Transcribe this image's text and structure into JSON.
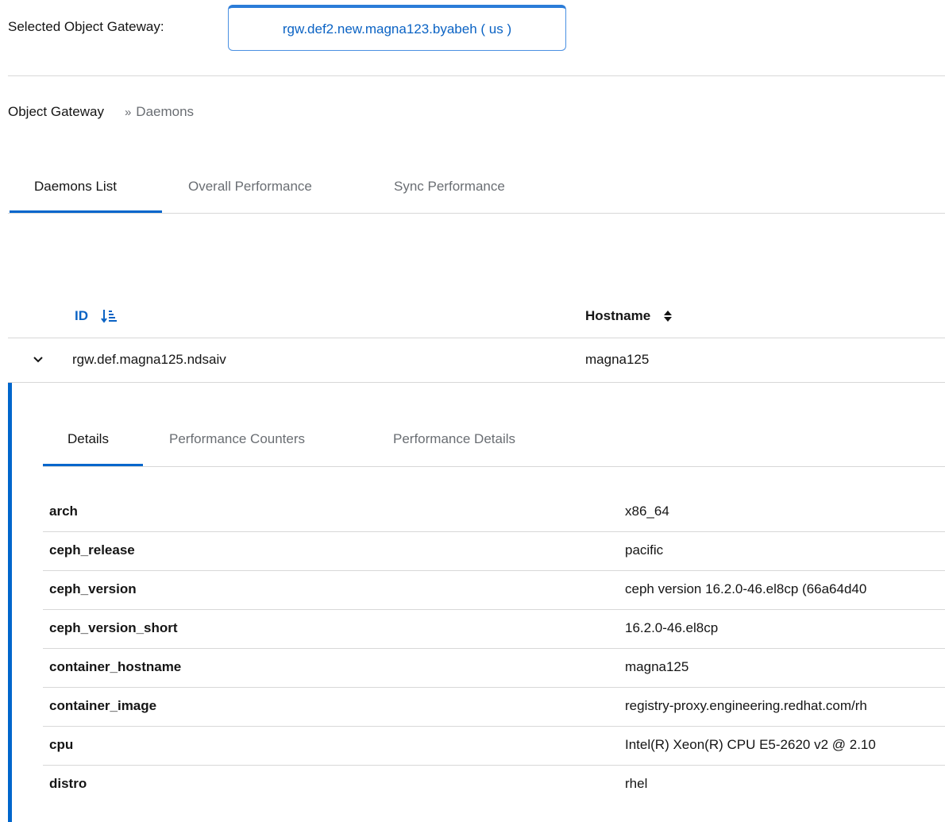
{
  "gateway": {
    "label": "Selected Object Gateway:",
    "selected": "rgw.def2.new.magna123.byabeh ( us )"
  },
  "breadcrumb": {
    "root": "Object Gateway",
    "separator": "»",
    "current": "Daemons"
  },
  "main_tabs": [
    {
      "label": "Daemons List",
      "active": true
    },
    {
      "label": "Overall Performance",
      "active": false
    },
    {
      "label": "Sync Performance",
      "active": false
    }
  ],
  "table": {
    "columns": [
      {
        "label": "ID",
        "sort": "descending-icon"
      },
      {
        "label": "Hostname",
        "sort": "sort-both-icon"
      }
    ],
    "rows": [
      {
        "id": "rgw.def.magna125.ndsaiv",
        "hostname": "magna125",
        "expanded": true
      }
    ]
  },
  "detail_tabs": [
    {
      "label": "Details",
      "active": true
    },
    {
      "label": "Performance Counters",
      "active": false
    },
    {
      "label": "Performance Details",
      "active": false
    }
  ],
  "details": [
    {
      "key": "arch",
      "value": "x86_64"
    },
    {
      "key": "ceph_release",
      "value": "pacific"
    },
    {
      "key": "ceph_version",
      "value": "ceph version 16.2.0-46.el8cp (66a64d40"
    },
    {
      "key": "ceph_version_short",
      "value": "16.2.0-46.el8cp"
    },
    {
      "key": "container_hostname",
      "value": "magna125"
    },
    {
      "key": "container_image",
      "value": "registry-proxy.engineering.redhat.com/rh"
    },
    {
      "key": "cpu",
      "value": "Intel(R) Xeon(R) CPU E5-2620 v2 @ 2.10"
    },
    {
      "key": "distro",
      "value": "rhel"
    }
  ],
  "colors": {
    "accent": "#0066cc",
    "link": "#0b63c4",
    "border": "#d8d8d8"
  }
}
